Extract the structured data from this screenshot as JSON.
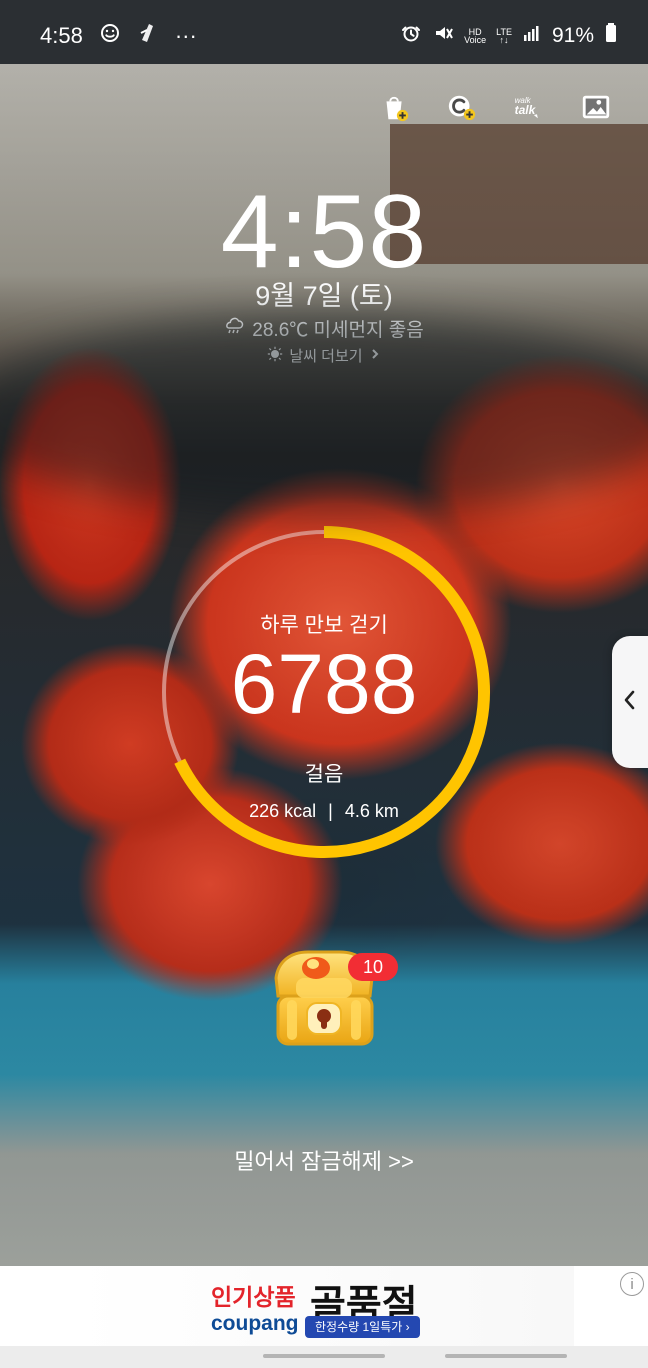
{
  "status_bar": {
    "time": "4:58",
    "more": "···",
    "hd_top": "HD",
    "hd_bottom": "Voice",
    "lte_top": "LTE",
    "lte_bottom": "↑↓",
    "battery": "91%"
  },
  "top_actions": [
    "shopping-bag-plus-icon",
    "coin-plus-icon",
    "walk-talk-icon",
    "image-icon"
  ],
  "walk_talk": {
    "line1": "walk",
    "line2": "talk"
  },
  "clock": {
    "time": "4:58",
    "date": "9월 7일 (토)"
  },
  "weather": {
    "summary": "28.6℃ 미세먼지 좋음",
    "more": "날씨 더보기"
  },
  "steps": {
    "title": "하루 만보 걷기",
    "count": "6788",
    "unit": "걸음",
    "calories": "226 kcal",
    "distance": "4.6 km",
    "progress": 0.6788
  },
  "reward": {
    "badge": "10"
  },
  "unlock": {
    "label": "밀어서 잠금해제 >>"
  },
  "ad": {
    "left_top": "인기상품",
    "left_bottom": "coupang",
    "right_top": "골품절",
    "pill": "한정수량 1일특가 ›",
    "info": "i"
  },
  "colors": {
    "ring_progress": "#ffc400",
    "ring_track": "#d8d8d8",
    "badge": "#f22d34",
    "ad_pill": "#2448b1",
    "ad_brand": "#0e4b96"
  }
}
